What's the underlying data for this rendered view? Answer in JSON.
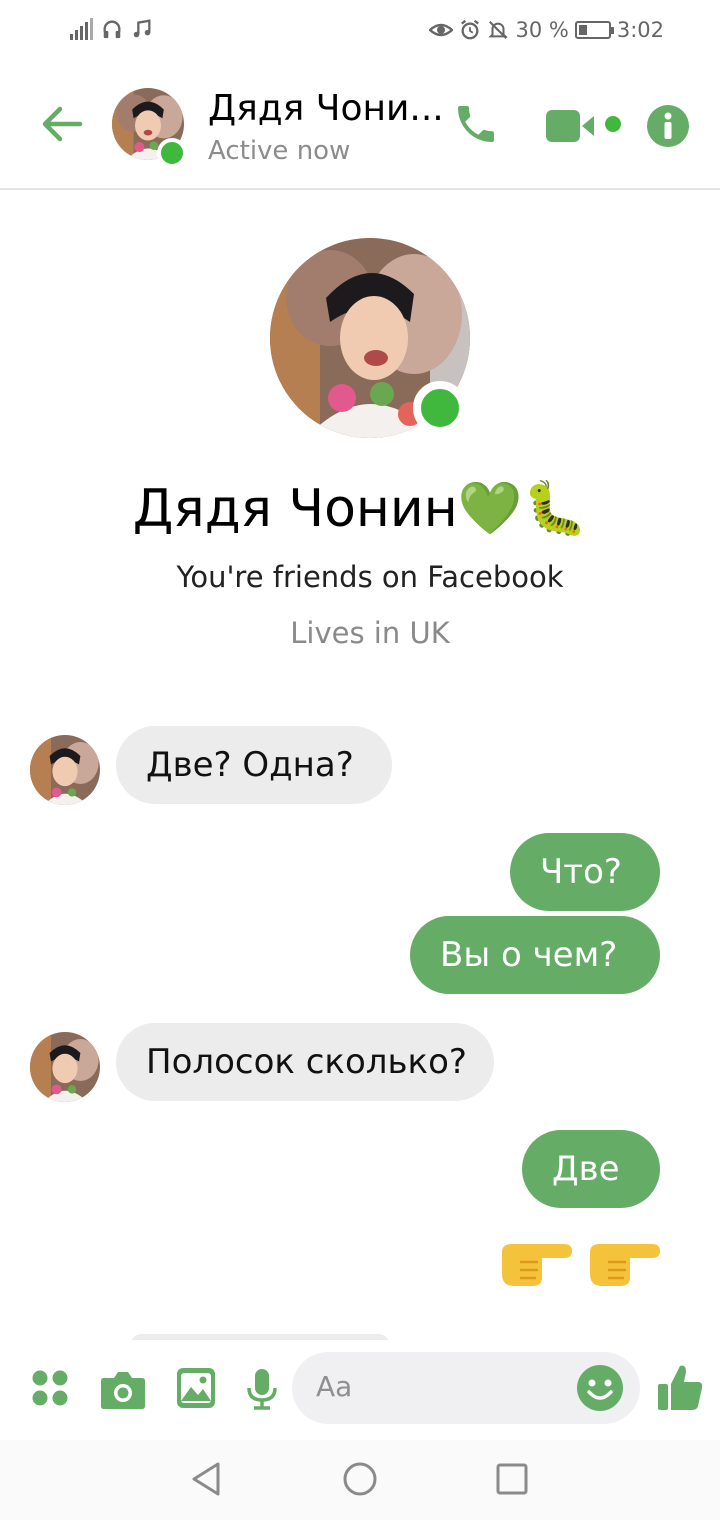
{
  "status_bar": {
    "battery_percent": "30 %",
    "battery_level": 0.3,
    "time": "3:02"
  },
  "header": {
    "name": "Дядя Чони...",
    "status": "Active now"
  },
  "profile": {
    "name": "Дядя Чонин💚🐛",
    "friends_text": "You're friends on Facebook",
    "location_text": "Lives in UK"
  },
  "messages": [
    {
      "direction": "incoming",
      "text": "Две? Одна?"
    },
    {
      "direction": "outgoing",
      "text": "Что?"
    },
    {
      "direction": "outgoing",
      "text": "Вы о чем?"
    },
    {
      "direction": "incoming",
      "text": "Полосок сколько?"
    },
    {
      "direction": "outgoing",
      "text": "Две"
    },
    {
      "direction": "outgoing",
      "text": "👉👉"
    }
  ],
  "composer": {
    "placeholder": "Aa"
  },
  "colors": {
    "accent": "#65ac66",
    "online": "#3fb83d",
    "incoming_bubble": "#ececec"
  }
}
